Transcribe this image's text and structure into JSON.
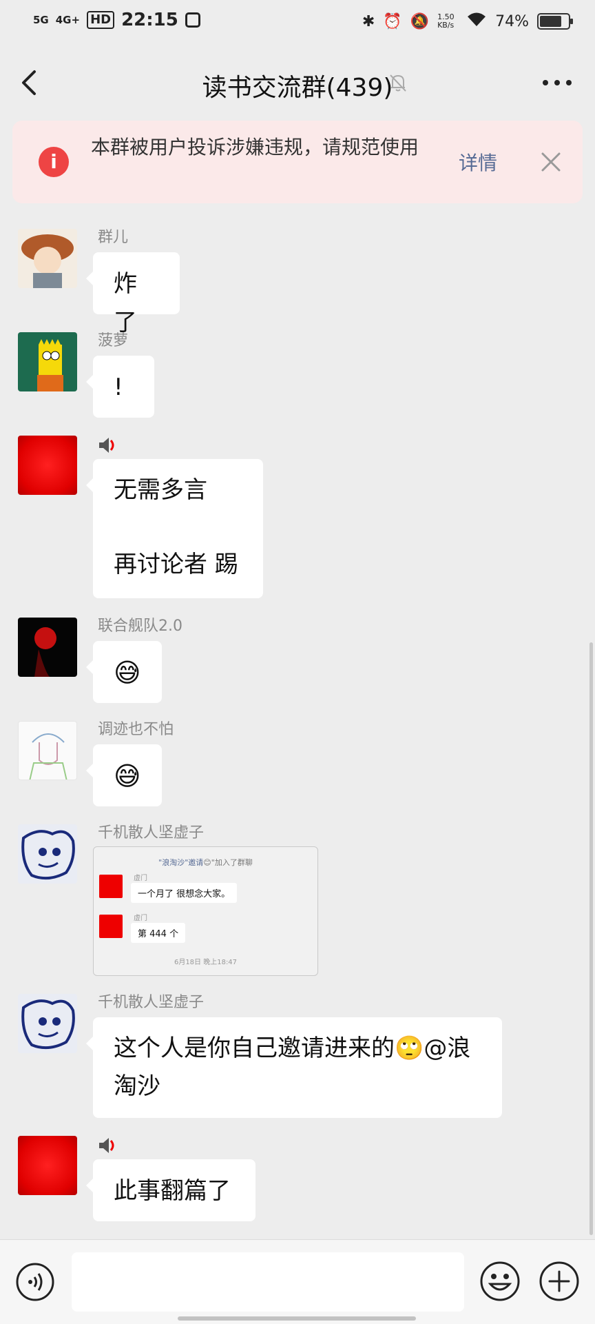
{
  "status_bar": {
    "net1": "5G",
    "net2": "4G+",
    "hd": "HD",
    "time": "22:15",
    "speed": "1.50 KB/s",
    "battery": "74%"
  },
  "header": {
    "title": "读书交流群(439)"
  },
  "notice": {
    "text": "本群被用户投诉涉嫌违规，请规范使用",
    "detail_label": "详情"
  },
  "messages": [
    {
      "sender": "群儿",
      "text": "炸了"
    },
    {
      "sender": "菠萝",
      "text": "!"
    },
    {
      "sender": "",
      "lines": [
        "无需多言",
        "再讨论者 踢"
      ]
    },
    {
      "sender": "联合舰队2.0",
      "text": "😅"
    },
    {
      "sender": "调迹也不怕",
      "text": "😅"
    },
    {
      "sender": "千机散人坚虚子",
      "screenshot": {
        "system_prefix": "\"浪淘沙\"邀请",
        "system_suffix": "加入了群聊",
        "rows": [
          {
            "name": "虚门",
            "text": "一个月了 很想念大家。"
          },
          {
            "name": "虚门",
            "text": "第 444 个"
          }
        ],
        "time": "6月18日 晚上18:47"
      }
    },
    {
      "sender": "千机散人坚虚子",
      "text": "这个人是你自己邀请进来的🙄@浪淘沙"
    },
    {
      "sender": "",
      "text": "此事翻篇了"
    }
  ]
}
